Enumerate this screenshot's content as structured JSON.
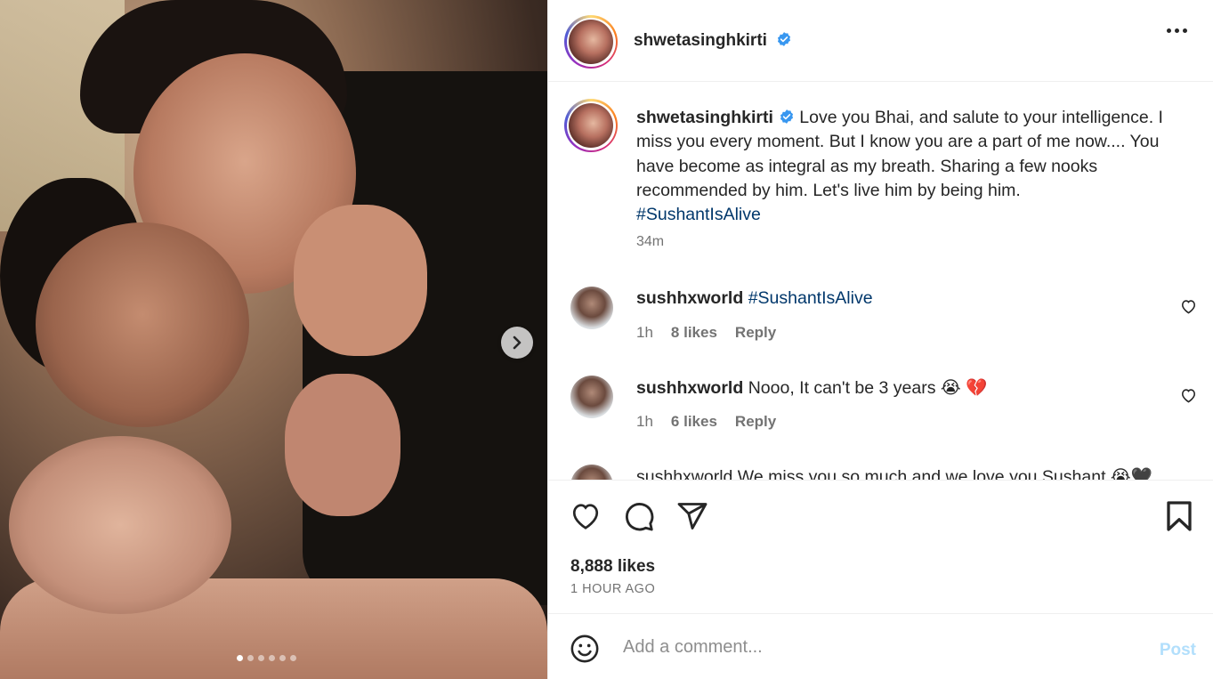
{
  "post": {
    "username": "shwetasinghkirti",
    "caption_text": " Love you Bhai, and salute to your intelligence. I miss you every moment. But I know you are a part of me now.... You have become as integral as my breath. Sharing a few nooks recommended by him. Let's live him by being him. ",
    "caption_hashtag": "#SushantIsAlive",
    "caption_time": "34m",
    "likes": "8,888 likes",
    "time_ago": "1 HOUR AGO"
  },
  "comments": [
    {
      "username": "sushhxworld",
      "text": "#SushantIsAlive",
      "is_hashtag": true,
      "time": "1h",
      "likes": "8 likes",
      "reply": "Reply"
    },
    {
      "username": "sushhxworld",
      "text": "Nooo, It can't be 3 years",
      "is_hashtag": false,
      "emoji": "😭 💔",
      "time": "1h",
      "likes": "6 likes",
      "reply": "Reply"
    }
  ],
  "partial_comment": "sushhxworld We miss you so much and we love you Sushant 😭🖤",
  "composer": {
    "placeholder": "Add a comment...",
    "post_label": "Post"
  },
  "carousel": {
    "total": 6,
    "active": 0
  },
  "colors": {
    "hashtag": "#00376b",
    "verified": "#3897f0",
    "post_disabled": "#b2dffc",
    "muted": "#737373"
  },
  "icons": [
    "chevron-right-icon",
    "verified-badge-icon",
    "more-options-icon",
    "heart-icon",
    "comment-icon",
    "share-icon",
    "bookmark-icon",
    "emoji-icon"
  ]
}
